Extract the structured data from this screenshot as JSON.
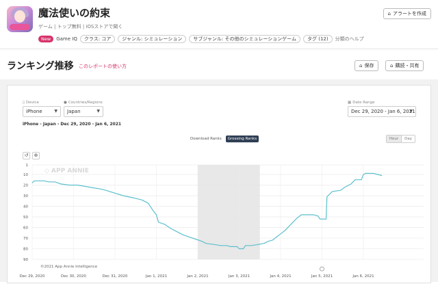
{
  "app": {
    "title": "魔法使いの約束",
    "meta": "ゲーム | トップ無料 | iOSストアで聞く",
    "tags": {
      "new": "New",
      "game_iq": "Game IQ",
      "chips": [
        "クラス: コア",
        "ジャンル: シミュレーション",
        "サブジャンル: その他のシミュレーションゲーム",
        "タグ (12)"
      ],
      "help": "分類のヘルプ"
    },
    "alert_button": "アラートを作成",
    "icon": "app-icon-anime-character"
  },
  "section": {
    "title": "ランキング推移",
    "link": "このレポートの使い方",
    "save": "保存",
    "share": "購読・共有"
  },
  "filters": {
    "device_label": "Device",
    "device_value": "iPhone",
    "country_label": "Countries/Regions",
    "country_value": "Japan",
    "date_label": "Date Range",
    "date_value": "Dec 29, 2020 - Jan 6, 2021",
    "subtitle": "iPhone - Japan - Dec 29, 2020 - Jan 6, 2021"
  },
  "rank_toggle": {
    "download": "Download Ranks",
    "grossing": "Grossing Ranks",
    "active": "Grossing Ranks"
  },
  "period": {
    "hour": "Hour",
    "day": "Day",
    "active": "Hour"
  },
  "tools": {
    "reset": "↺",
    "zoom": "⊕"
  },
  "watermark": "APP ANNIE",
  "copyright": "©2021 App Annie Intelligence",
  "colors": {
    "accent": "#d6336c",
    "line": "#5bbfcc",
    "dark": "#2f3f55",
    "shade": "#e8e8e8"
  },
  "chart_data": {
    "type": "line",
    "title": "",
    "xlabel": "",
    "ylabel": "",
    "y_inverted": true,
    "ylim": [
      1,
      90
    ],
    "yticks": [
      1,
      10,
      20,
      30,
      40,
      50,
      60,
      70,
      80,
      90
    ],
    "xlim": [
      "Dec 29, 2020",
      "Jan 6, 2021 12:00"
    ],
    "xticks": [
      "Dec 29, 2020",
      "Dec 30, 2020",
      "Dec 31, 2020",
      "Jan 1, 2021",
      "Jan 2, 2021",
      "Jan 3, 2021",
      "Jan 4, 2021",
      "Jan 5, 2021",
      "Jan 6, 2021"
    ],
    "shaded_range": [
      "Jan 2, 2021",
      "Jan 3, 2021 12:00"
    ],
    "marker": "Jan 5, 2021",
    "series": [
      {
        "name": "",
        "x_unit": "days since Dec 29, 2020",
        "points": [
          [
            0,
            18
          ],
          [
            0.05,
            16
          ],
          [
            0.3,
            16
          ],
          [
            0.4,
            17
          ],
          [
            0.55,
            17
          ],
          [
            0.7,
            19
          ],
          [
            0.9,
            20
          ],
          [
            1.1,
            20
          ],
          [
            1.4,
            22
          ],
          [
            1.7,
            24
          ],
          [
            1.95,
            27
          ],
          [
            2.2,
            30
          ],
          [
            2.45,
            32
          ],
          [
            2.65,
            34
          ],
          [
            2.8,
            37
          ],
          [
            2.92,
            44
          ],
          [
            3.0,
            48
          ],
          [
            3.05,
            55
          ],
          [
            3.2,
            57
          ],
          [
            3.35,
            61
          ],
          [
            3.5,
            64
          ],
          [
            3.65,
            67
          ],
          [
            3.8,
            69
          ],
          [
            3.95,
            71
          ],
          [
            4.1,
            73
          ],
          [
            4.2,
            75
          ],
          [
            4.4,
            76
          ],
          [
            4.55,
            77
          ],
          [
            4.7,
            77
          ],
          [
            4.8,
            78
          ],
          [
            4.95,
            78
          ],
          [
            5.0,
            80
          ],
          [
            5.1,
            80
          ],
          [
            5.15,
            77
          ],
          [
            5.3,
            77
          ],
          [
            5.45,
            76
          ],
          [
            5.6,
            75
          ],
          [
            5.7,
            73
          ],
          [
            5.8,
            72
          ],
          [
            5.9,
            69
          ],
          [
            6.0,
            66
          ],
          [
            6.1,
            63
          ],
          [
            6.2,
            59
          ],
          [
            6.3,
            55
          ],
          [
            6.4,
            51
          ],
          [
            6.5,
            48
          ],
          [
            6.6,
            48
          ],
          [
            6.8,
            48
          ],
          [
            6.9,
            49
          ],
          [
            6.95,
            52
          ],
          [
            7.1,
            52
          ],
          [
            7.12,
            31
          ],
          [
            7.25,
            26
          ],
          [
            7.45,
            25
          ],
          [
            7.55,
            22
          ],
          [
            7.7,
            19
          ],
          [
            7.8,
            15
          ],
          [
            7.95,
            15
          ],
          [
            8.0,
            10
          ],
          [
            8.05,
            9
          ],
          [
            8.25,
            9
          ],
          [
            8.35,
            10
          ],
          [
            8.45,
            11
          ]
        ]
      }
    ]
  }
}
